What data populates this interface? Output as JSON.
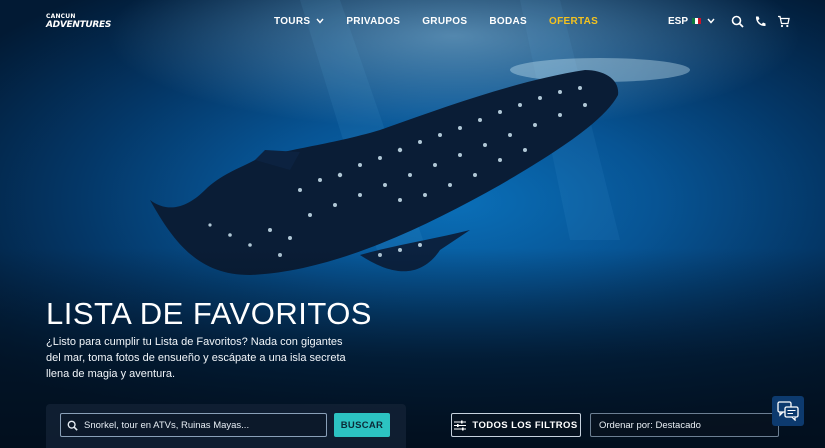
{
  "brand": {
    "logo_line1": "CANCUN",
    "logo_line2": "ADVENTURES"
  },
  "nav": {
    "items": [
      {
        "label": "TOURS",
        "has_dropdown": true
      },
      {
        "label": "PRIVADOS"
      },
      {
        "label": "GRUPOS"
      },
      {
        "label": "BODAS"
      },
      {
        "label": "OFERTAS",
        "highlight_color": "#f4c21f"
      }
    ]
  },
  "header_tools": {
    "language": "ESP",
    "icons": [
      "search-icon",
      "phone-icon",
      "cart-icon"
    ]
  },
  "hero": {
    "title": "LISTA DE FAVORITOS",
    "description": "¿Listo para cumplir tu Lista de Favoritos? Nada con gigantes del mar, toma fotos de ensueño y escápate a una isla secreta llena de magia y aventura."
  },
  "search": {
    "placeholder": "Snorkel, tour en ATVs, Ruinas Mayas...",
    "button_label": "BUSCAR",
    "button_color": "#2cc3c2"
  },
  "filters": {
    "all_filters_label": "TODOS LOS FILTROS",
    "sort_label": "Ordenar por: Destacado"
  },
  "chat": {
    "icon": "chat-icon"
  }
}
